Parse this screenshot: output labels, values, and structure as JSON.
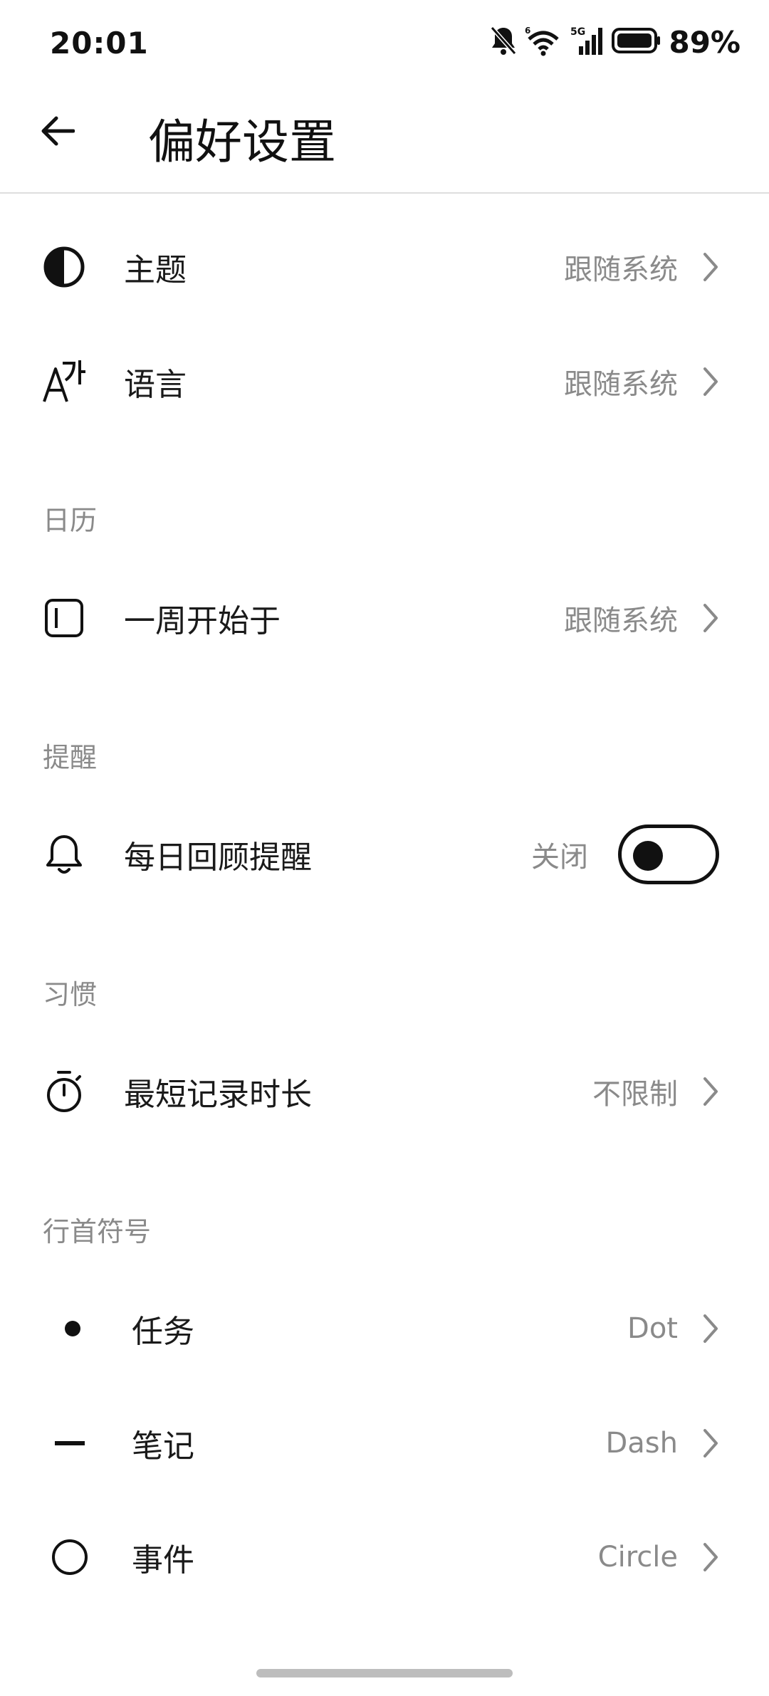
{
  "status_bar": {
    "time": "20:01",
    "battery_pct": "89%",
    "network": "5G"
  },
  "app_bar": {
    "title": "偏好设置"
  },
  "general": [
    {
      "label": "主题",
      "value": "跟随系统",
      "icon": "theme-contrast-icon"
    },
    {
      "label": "语言",
      "value": "跟随系统",
      "icon": "language-icon"
    }
  ],
  "calendar": {
    "header": "日历",
    "week_start": {
      "label": "一周开始于",
      "value": "跟随系统",
      "icon": "calendar-week-icon"
    }
  },
  "reminder": {
    "header": "提醒",
    "daily_review": {
      "label": "每日回顾提醒",
      "state_text": "关闭",
      "enabled": false,
      "icon": "bell-icon"
    }
  },
  "habit": {
    "header": "习惯",
    "min_duration": {
      "label": "最短记录时长",
      "value": "不限制",
      "icon": "stopwatch-icon"
    }
  },
  "bullets": {
    "header": "行首符号",
    "items": [
      {
        "label": "任务",
        "value": "Dot",
        "icon": "dot-icon"
      },
      {
        "label": "笔记",
        "value": "Dash",
        "icon": "dash-icon"
      },
      {
        "label": "事件",
        "value": "Circle",
        "icon": "circle-icon"
      }
    ]
  }
}
